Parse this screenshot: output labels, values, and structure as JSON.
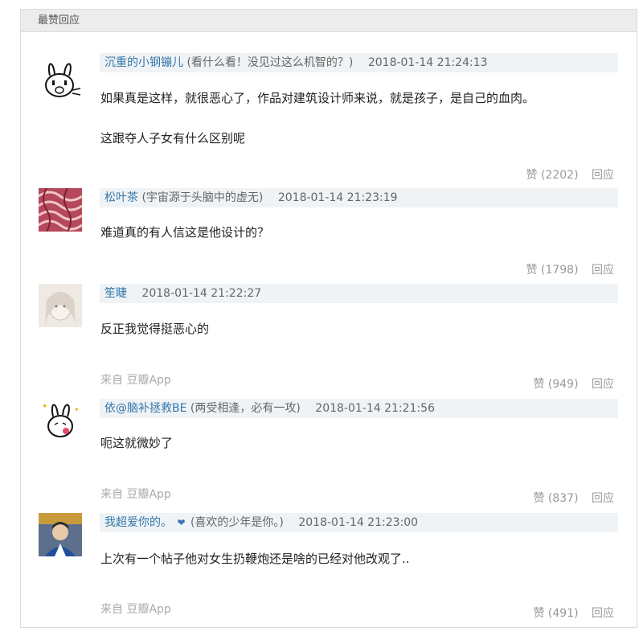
{
  "panel": {
    "title": "最赞回应"
  },
  "comments": [
    {
      "author": "沉重的小钢镚儿",
      "signature": "(看什么看！没见过这么机智的？)",
      "time": "2018-01-14 21:24:13",
      "lines": [
        "如果真是这样，就很恶心了，作品对建筑设计师来说，就是孩子，是自己的血肉。",
        "这跟夺人子女有什么区别呢"
      ],
      "likes": "赞 (2202)",
      "reply": "回应",
      "source": ""
    },
    {
      "author": "松叶茶",
      "signature": "(宇宙源于头脑中的虚无)",
      "time": "2018-01-14 21:23:19",
      "lines": [
        "难道真的有人信这是他设计的？"
      ],
      "likes": "赞 (1798)",
      "reply": "回应",
      "source": ""
    },
    {
      "author": "笙睫",
      "signature": "",
      "time": "2018-01-14 21:22:27",
      "lines": [
        "反正我觉得挺恶心的"
      ],
      "likes": "赞 (949)",
      "reply": "回应",
      "source": "来自 豆瓣App"
    },
    {
      "author": "依@脑补拯救BE",
      "signature": "(两受相逢，必有一攻)",
      "time": "2018-01-14 21:21:56",
      "lines": [
        "呃这就微妙了"
      ],
      "likes": "赞 (837)",
      "reply": "回应",
      "source": "来自 豆瓣App"
    },
    {
      "author": "我超爱你的。",
      "heart": "❤",
      "signature": "(喜欢的少年是你。)",
      "time": "2018-01-14 21:23:00",
      "lines": [
        "上次有一个帖子他对女生扔鞭炮还是啥的已经对他改观了.."
      ],
      "likes": "赞 (491)",
      "reply": "回应",
      "source": "来自 豆瓣App"
    }
  ]
}
